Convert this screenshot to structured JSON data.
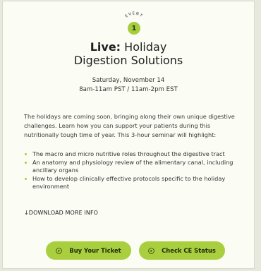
{
  "event": {
    "label": "EVENT",
    "number": "1"
  },
  "title": {
    "prefix": "Live:",
    "rest": "Holiday",
    "line2": "Digestion Solutions"
  },
  "date": {
    "line1": "Saturday, November 14",
    "line2": "8am-11am PST / 11am-2pm EST"
  },
  "description": [
    "The holidays are coming soon, bringing along their own unique digestive",
    "challenges. Learn how you can support your patients during this",
    "nutritionally tough time of year. This 3-hour seminar will highlight:"
  ],
  "highlights": [
    [
      "The macro and micro nutritive roles throughout the digestive tract"
    ],
    [
      "An anatomy and physiology review of the alimentary canal, including",
      "ancillary organs"
    ],
    [
      "How to develop clinically effective protocols specific to the holiday",
      "environment"
    ]
  ],
  "download_label": "↓DOWNLOAD MORE INFO",
  "buttons": {
    "buy": "Buy Your Ticket",
    "ce": "Check CE Status"
  },
  "colors": {
    "accent": "#a9cf3f",
    "card": "#fbfcf4",
    "background": "#e6e9dc"
  }
}
